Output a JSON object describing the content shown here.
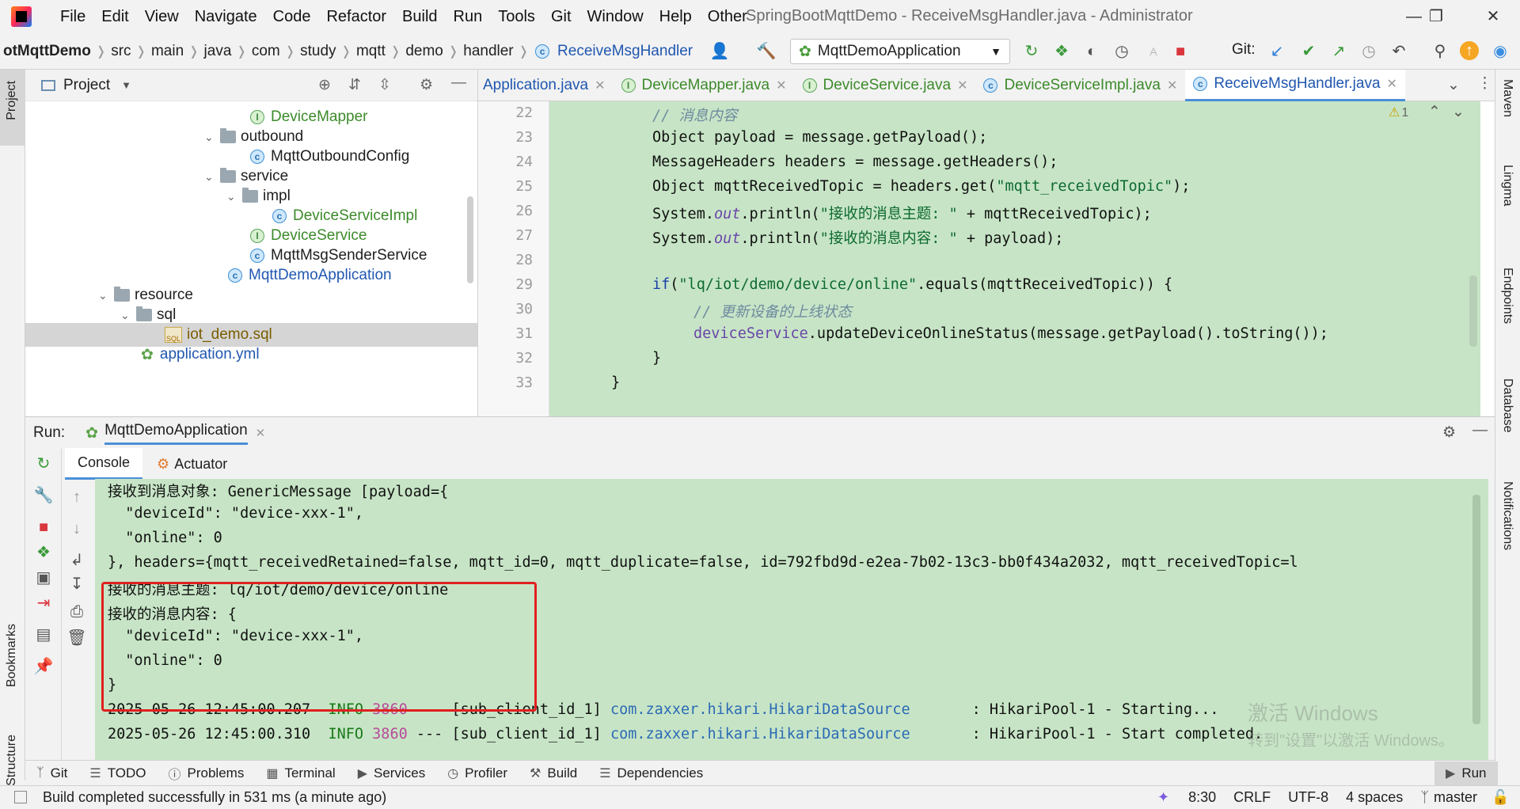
{
  "menu": [
    "File",
    "Edit",
    "View",
    "Navigate",
    "Code",
    "Refactor",
    "Build",
    "Run",
    "Tools",
    "Git",
    "Window",
    "Help",
    "Other"
  ],
  "window_title": "SpringBootMqttDemo - ReceiveMsgHandler.java - Administrator",
  "breadcrumb": [
    "otMqttDemo",
    "src",
    "main",
    "java",
    "com",
    "study",
    "mqtt",
    "demo",
    "handler",
    "ReceiveMsgHandler"
  ],
  "run_config": "MqttDemoApplication",
  "git_label": "Git:",
  "left_strip": {
    "project": "Project",
    "bookmarks": "Bookmarks",
    "structure": "Structure"
  },
  "right_strip": {
    "maven": "Maven",
    "lingma": "Lingma",
    "endpoints": "Endpoints",
    "database": "Database",
    "notifications": "Notifications"
  },
  "project_panel": {
    "title": "Project",
    "tree": [
      {
        "label": "DeviceMapper",
        "kind": "iface"
      },
      {
        "label": "outbound",
        "kind": "folder"
      },
      {
        "label": "MqttOutboundConfig",
        "kind": "class"
      },
      {
        "label": "service",
        "kind": "folder"
      },
      {
        "label": "impl",
        "kind": "folder"
      },
      {
        "label": "DeviceServiceImpl",
        "kind": "class"
      },
      {
        "label": "DeviceService",
        "kind": "iface"
      },
      {
        "label": "MqttMsgSenderService",
        "kind": "class"
      },
      {
        "label": "MqttDemoApplication",
        "kind": "class"
      },
      {
        "label": "resource",
        "kind": "folder"
      },
      {
        "label": "sql",
        "kind": "folder"
      },
      {
        "label": "iot_demo.sql",
        "kind": "sql"
      },
      {
        "label": "application.yml",
        "kind": "yml"
      }
    ]
  },
  "editor_tabs": [
    {
      "label": "Application.java"
    },
    {
      "label": "DeviceMapper.java"
    },
    {
      "label": "DeviceService.java"
    },
    {
      "label": "DeviceServiceImpl.java"
    },
    {
      "label": "ReceiveMsgHandler.java"
    }
  ],
  "warning_count": "1",
  "line_numbers": [
    "22",
    "23",
    "24",
    "25",
    "26",
    "27",
    "28",
    "29",
    "30",
    "31",
    "32",
    "33"
  ],
  "code": {
    "l22": "// 消息内容",
    "l23a": "Object payload = message.getPayload();",
    "l24a": "MessageHeaders headers = message.getHeaders();",
    "l25a": "Object mqttReceivedTopic = headers.get(",
    "l25b": "\"mqtt_receivedTopic\"",
    "l25c": ");",
    "l26a": "System.",
    "l26b": "out",
    "l26c": ".println(",
    "l26d": "\"接收的消息主题: \"",
    "l26e": " + mqttReceivedTopic);",
    "l27a": "System.",
    "l27b": "out",
    "l27c": ".println(",
    "l27d": "\"接收的消息内容: \"",
    "l27e": " + payload);",
    "l29a": "if",
    "l29b": "(",
    "l29c": "\"lq/iot/demo/device/online\"",
    "l29d": ".equals(mqttReceivedTopic)) {",
    "l30": "// 更新设备的上线状态",
    "l31a": "deviceService",
    "l31b": ".updateDeviceOnlineStatus(message.getPayload().toString());",
    "l32": "}",
    "l33": "}"
  },
  "run_panel": {
    "label": "Run:",
    "tab": "MqttDemoApplication",
    "console_tab": "Console",
    "actuator_tab": "Actuator"
  },
  "console_lines": {
    "c1": "接收到消息对象: GenericMessage [payload={",
    "c2": "  \"deviceId\": \"device-xxx-1\",",
    "c3": "  \"online\": 0",
    "c4": "}, headers={mqtt_receivedRetained=false, mqtt_id=0, mqtt_duplicate=false, id=792fbd9d-e2ea-7b02-13c3-bb0f434a2032, mqtt_receivedTopic=l",
    "c5": "接收的消息主题: lq/iot/demo/device/online",
    "c6": "接收的消息内容: {",
    "c7": "  \"deviceId\": \"device-xxx-1\",",
    "c8": "  \"online\": 0",
    "c9": "}",
    "log1_ts": "2025-05-26 12:45:00.207",
    "log1_level": "INFO",
    "log1_pid": "3860",
    "log1_sep": "---",
    "log1_thread": "[sub_client_id_1]",
    "log1_class": "com.zaxxer.hikari.HikariDataSource",
    "log1_msg": ": HikariPool-1 - Starting...",
    "log2_ts": "2025-05-26 12:45:00.310",
    "log2_level": "INFO",
    "log2_pid": "3860",
    "log2_sep": "---",
    "log2_thread": "[sub_client_id_1]",
    "log2_class": "com.zaxxer.hikari.HikariDataSource",
    "log2_msg": ": HikariPool-1 - Start completed."
  },
  "watermark": {
    "line1": "激活 Windows",
    "line2": "转到\"设置\"以激活 Windows。"
  },
  "bottom_tools": [
    "Git",
    "TODO",
    "Problems",
    "Terminal",
    "Services",
    "Profiler",
    "Build",
    "Dependencies"
  ],
  "run_button": "Run",
  "status": {
    "message": "Build completed successfully in 531 ms (a minute ago)",
    "position": "8:30",
    "line_sep": "CRLF",
    "encoding": "UTF-8",
    "indent": "4 spaces",
    "branch": "master"
  },
  "colors": {
    "editor_bg": "#c7e5c6",
    "highlight": "#e02020",
    "accent": "#4a8fd8"
  }
}
